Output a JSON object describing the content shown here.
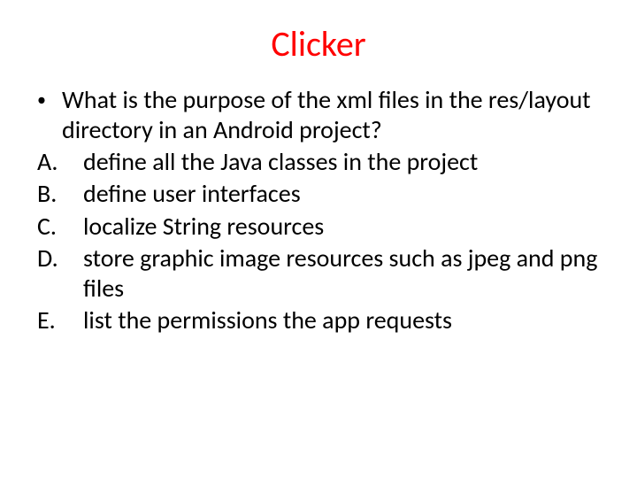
{
  "title": "Clicker",
  "question": "What is the purpose of the xml files in the res/layout directory in an Android project?",
  "options": [
    {
      "label": "A.",
      "text": "define all the Java classes in the project"
    },
    {
      "label": "B.",
      "text": "define user interfaces"
    },
    {
      "label": "C.",
      "text": "localize String resources"
    },
    {
      "label": "D.",
      "text": "store graphic image resources such as jpeg and png files"
    },
    {
      "label": "E.",
      "text": "list the permissions the app requests"
    }
  ]
}
